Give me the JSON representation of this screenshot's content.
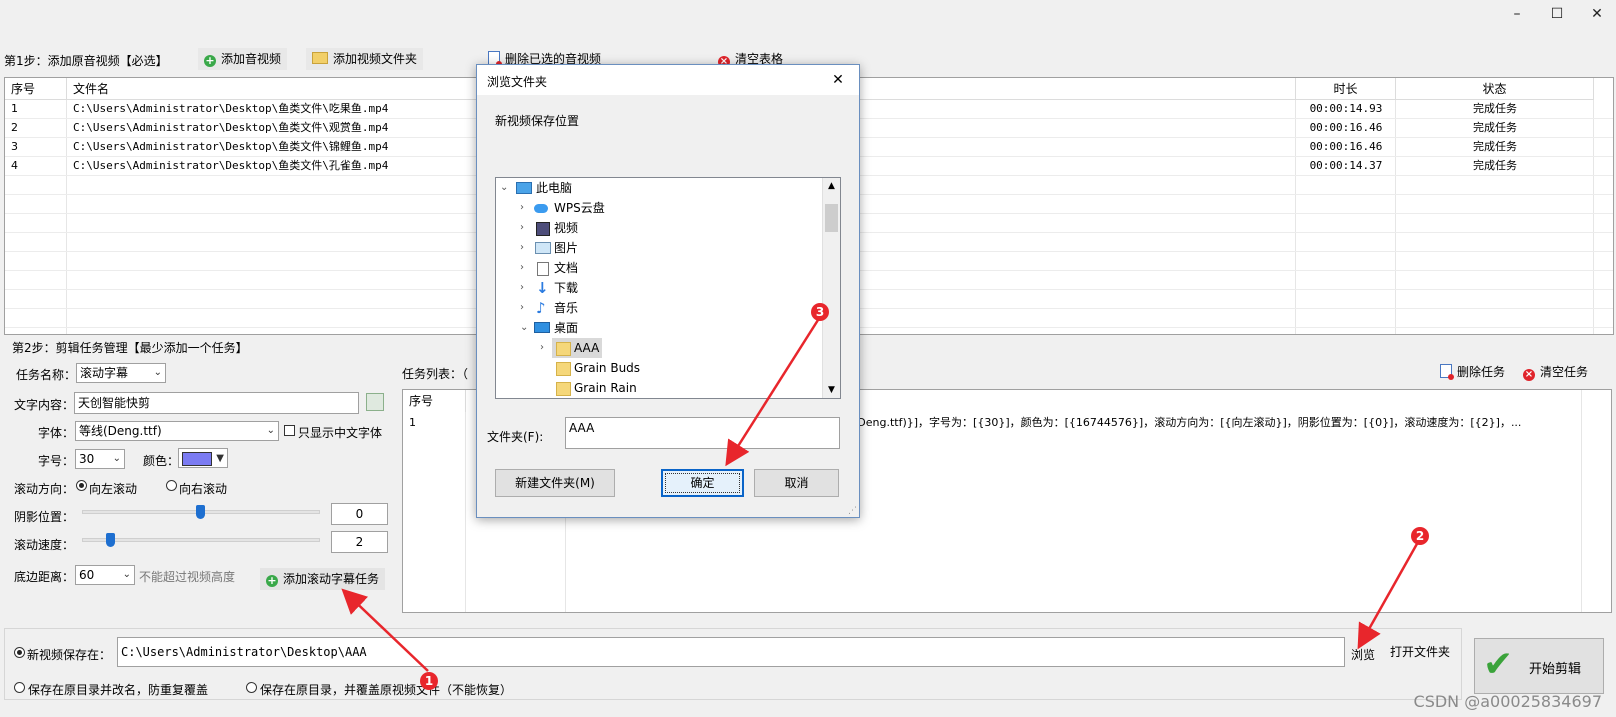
{
  "window": {
    "minimize": "–",
    "maximize": "☐",
    "close": "✕"
  },
  "step1": {
    "label": "第1步：添加原音视频【必选】",
    "add_video": "添加音视频",
    "add_folder": "添加视频文件夹",
    "delete_selected": "删除已选的音视频",
    "clear_table": "清空表格"
  },
  "table1": {
    "headers": [
      "序号",
      "文件名",
      "时长",
      "状态"
    ],
    "rows": [
      {
        "no": "1",
        "file": "C:\\Users\\Administrator\\Desktop\\鱼类文件\\吃果鱼.mp4",
        "duration": "00:00:14.93",
        "status": "完成任务"
      },
      {
        "no": "2",
        "file": "C:\\Users\\Administrator\\Desktop\\鱼类文件\\观赏鱼.mp4",
        "duration": "00:00:16.46",
        "status": "完成任务"
      },
      {
        "no": "3",
        "file": "C:\\Users\\Administrator\\Desktop\\鱼类文件\\锦鲤鱼.mp4",
        "duration": "00:00:16.46",
        "status": "完成任务"
      },
      {
        "no": "4",
        "file": "C:\\Users\\Administrator\\Desktop\\鱼类文件\\孔雀鱼.mp4",
        "duration": "00:00:14.37",
        "status": "完成任务"
      }
    ]
  },
  "step2": {
    "label": "第2步：剪辑任务管理【最少添加一个任务】",
    "task_name_label": "任务名称：",
    "task_name_value": "滚动字幕",
    "text_label": "文字内容：",
    "text_value": "天创智能快剪",
    "font_label": "字体：",
    "font_value": "等线(Deng.ttf)",
    "only_chinese": "只显示中文字体",
    "size_label": "字号：",
    "size_value": "30",
    "color_label": "颜色：",
    "color_hex": "#7b7bf2",
    "direction_label": "滚动方向：",
    "dir_left": "向左滚动",
    "dir_right": "向右滚动",
    "shadow_label": "阴影位置：",
    "shadow_value": "0",
    "speed_label": "滚动速度：",
    "speed_value": "2",
    "bottom_label": "底边距离：",
    "bottom_value": "60",
    "bottom_hint": "不能超过视频高度",
    "add_task": "添加滚动字幕任务"
  },
  "tasks": {
    "label": "任务列表：（",
    "delete_task": "删除任务",
    "clear_tasks": "清空任务",
    "header_no": "序号",
    "row_no": "1",
    "row_desc": "(Deng.ttf)}]，字号为：[{30}]，颜色为：[{16744576}]，滚动方向为：[{向左滚动}]，阴影位置为：[{0}]，滚动速度为：[{2}]，..."
  },
  "output": {
    "save_to_label": "新视频保存在：",
    "path": "C:\\Users\\Administrator\\Desktop\\AAA",
    "browse": "浏览",
    "open_folder": "打开文件夹",
    "opt_rename": "保存在原目录并改名，防重复覆盖",
    "opt_overwrite": "保存在原目录，并覆盖原视频文件（不能恢复）",
    "start": "开始剪辑"
  },
  "dialog": {
    "title": "浏览文件夹",
    "close": "✕",
    "prompt": "新视频保存位置",
    "tree": [
      {
        "label": "此电脑",
        "icon": "monitor-icon"
      },
      {
        "label": "WPS云盘",
        "icon": "cloud-icon"
      },
      {
        "label": "视频",
        "icon": "video-icon"
      },
      {
        "label": "图片",
        "icon": "picture-icon"
      },
      {
        "label": "文档",
        "icon": "document-icon"
      },
      {
        "label": "下载",
        "icon": "download-icon"
      },
      {
        "label": "音乐",
        "icon": "music-icon"
      },
      {
        "label": "桌面",
        "icon": "desktop-icon"
      },
      {
        "label": "AAA",
        "icon": "folder-icon"
      },
      {
        "label": "Grain Buds",
        "icon": "folder-icon"
      },
      {
        "label": "Grain Rain",
        "icon": "folder-icon"
      }
    ],
    "folder_label": "文件夹(F):",
    "folder_value": "AAA",
    "new_folder": "新建文件夹(M)",
    "ok": "确定",
    "cancel": "取消"
  },
  "annotations": {
    "b1": "1",
    "b2": "2",
    "b3": "3"
  },
  "watermark": "CSDN @a00025834697"
}
